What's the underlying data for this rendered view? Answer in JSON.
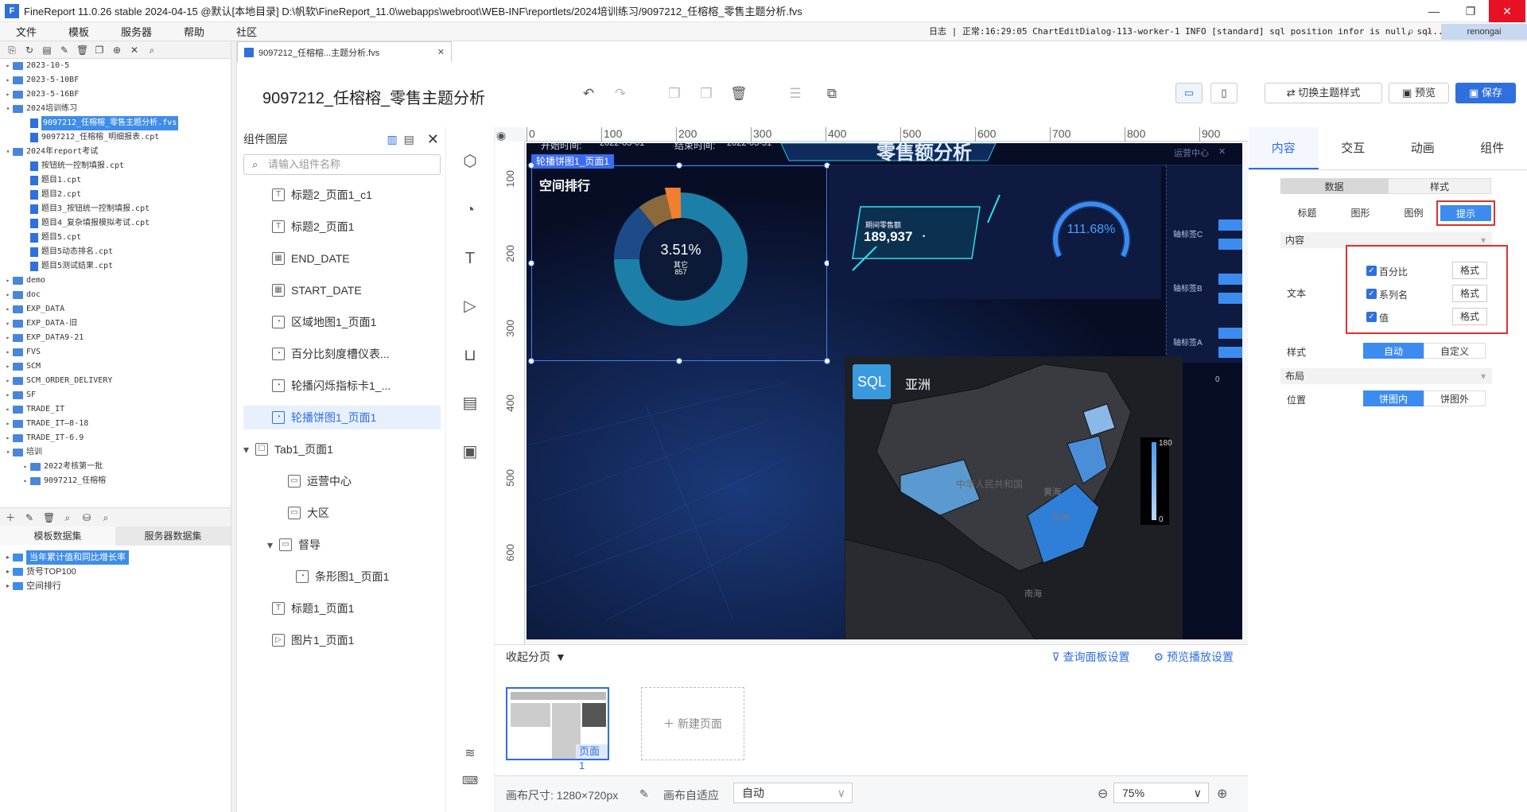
{
  "window": {
    "title": "FineReport 11.0.26 stable 2024-04-15 @默认[本地目录]    D:\\帆软\\FineReport_11.0\\webapps\\webroot\\WEB-INF\\reportlets/2024培训练习/9097212_任榕榕_零售主题分析.fvs",
    "logo_text": "F"
  },
  "menu": [
    "文件",
    "模板",
    "服务器",
    "帮助",
    "社区"
  ],
  "log": {
    "label": "日志",
    "line": "| 正常:16:29:05 ChartEditDialog-113-worker-1 INFO [standard] sql position infor is null, sql...",
    "user": "renongai"
  },
  "tree": [
    {
      "label": "2023-10-5",
      "type": "folder",
      "level": 0
    },
    {
      "label": "2023-5-10BF",
      "type": "folder",
      "level": 0
    },
    {
      "label": "2023-5-16BF",
      "type": "folder",
      "level": 0
    },
    {
      "label": "2024培训练习",
      "type": "folder",
      "level": 0,
      "open": true
    },
    {
      "label": "9097212_任榕榕_零售主题分析.fvs",
      "type": "file",
      "level": 1,
      "selected": true
    },
    {
      "label": "9097212_任榕榕_明细报表.cpt",
      "type": "file",
      "level": 1
    },
    {
      "label": "2024年report考试",
      "type": "folder",
      "level": 0,
      "open": true
    },
    {
      "label": "按钮统一控制填报.cpt",
      "type": "file",
      "level": 1
    },
    {
      "label": "题目1.cpt",
      "type": "file",
      "level": 1
    },
    {
      "label": "题目2.cpt",
      "type": "file",
      "level": 1
    },
    {
      "label": "题目3_按钮统一控制填报.cpt",
      "type": "file",
      "level": 1
    },
    {
      "label": "题目4_复杂填报模拟考试.cpt",
      "type": "file",
      "level": 1
    },
    {
      "label": "题目5.cpt",
      "type": "file",
      "level": 1
    },
    {
      "label": "题目5动态排名.cpt",
      "type": "file",
      "level": 1
    },
    {
      "label": "题目5测试结果.cpt",
      "type": "file",
      "level": 1
    },
    {
      "label": "demo",
      "type": "folder",
      "level": 0
    },
    {
      "label": "doc",
      "type": "folder",
      "level": 0
    },
    {
      "label": "EXP_DATA",
      "type": "folder",
      "level": 0
    },
    {
      "label": "EXP_DATA-旧",
      "type": "folder",
      "level": 0
    },
    {
      "label": "EXP_DATA9-21",
      "type": "folder",
      "level": 0
    },
    {
      "label": "FVS",
      "type": "folder",
      "level": 0
    },
    {
      "label": "SCM",
      "type": "folder",
      "level": 0
    },
    {
      "label": "SCM_ORDER_DELIVERY",
      "type": "folder",
      "level": 0
    },
    {
      "label": "SF",
      "type": "folder",
      "level": 0
    },
    {
      "label": "TRADE_IT",
      "type": "folder",
      "level": 0
    },
    {
      "label": "TRADE_IT—8-18",
      "type": "folder",
      "level": 0
    },
    {
      "label": "TRADE_IT-6.9",
      "type": "folder",
      "level": 0
    },
    {
      "label": "培训",
      "type": "folder",
      "level": 0,
      "open": true
    },
    {
      "label": "2022考核第一批",
      "type": "folder",
      "level": 1
    },
    {
      "label": "9097212_任榕榕",
      "type": "folder",
      "level": 1
    }
  ],
  "datasets": {
    "tabs": [
      "模板数据集",
      "服务器数据集"
    ],
    "items": [
      "当年累计值和同比增长率",
      "货号TOP100",
      "空间排行"
    ]
  },
  "doc_tab": "9097212_任榕榕...主题分析.fvs",
  "page_title": "9097212_任榕榕_零售主题分析",
  "toolbar": {
    "switch_theme": "切换主题样式",
    "preview": "预览",
    "save": "保存"
  },
  "layers": {
    "title": "组件图层",
    "search_placeholder": "请输入组件名称",
    "items": [
      {
        "label": "标题2_页面1_c1",
        "icon": "T",
        "indent": 0
      },
      {
        "label": "标题2_页面1",
        "icon": "T",
        "indent": 0
      },
      {
        "label": "END_DATE",
        "icon": "▦",
        "indent": 0
      },
      {
        "label": "START_DATE",
        "icon": "▦",
        "indent": 0
      },
      {
        "label": "区域地图1_页面1",
        "icon": "◔",
        "indent": 0
      },
      {
        "label": "百分比刻度槽仪表...",
        "icon": "◔",
        "indent": 0
      },
      {
        "label": "轮播闪烁指标卡1_...",
        "icon": "◔",
        "indent": 0
      },
      {
        "label": "轮播饼图1_页面1",
        "icon": "◔",
        "indent": 0,
        "selected": true
      },
      {
        "label": "Tab1_页面1",
        "icon": "☐",
        "indent": -1,
        "caret": true
      },
      {
        "label": "运营中心",
        "icon": "▭",
        "indent": 1
      },
      {
        "label": "大区",
        "icon": "▭",
        "indent": 1
      },
      {
        "label": "督导",
        "icon": "▭",
        "indent": 0.5,
        "caret": true
      },
      {
        "label": "条形图1_页面1",
        "icon": "◔",
        "indent": 1.5
      },
      {
        "label": "标题1_页面1",
        "icon": "T",
        "indent": 0
      },
      {
        "label": "图片1_页面1",
        "icon": "▷",
        "indent": 0
      }
    ]
  },
  "ruler": [
    "0",
    "100",
    "200",
    "300",
    "400",
    "500",
    "600",
    "700",
    "800",
    "900"
  ],
  "ruler_v": [
    "100",
    "200",
    "300",
    "400",
    "500",
    "600"
  ],
  "dashboard": {
    "heading": "零售额分析",
    "start_label": "开始时间:",
    "start_value": "2022-03-01",
    "end_label": "结束时间:",
    "end_value": "2022-03-31",
    "selected_component": "轮播饼图1_页面1",
    "pie_title": "空间排行",
    "pie_percent": "3.51%",
    "pie_label": "其它",
    "pie_value": "857",
    "kpi_label": "期间零售额",
    "kpi_value": "189,937",
    "kpi_suffix": "•",
    "gauge_value": "111.68%",
    "tab_label": "运营中心",
    "bar_labels": [
      "轴标签C",
      "轴标签B",
      "轴标签A"
    ],
    "bar_zero": "0",
    "map_logo": "SQL",
    "map_title": "亚洲",
    "map_labels": [
      "中华人民共和国",
      "黄海",
      "东海",
      "南海"
    ],
    "legend_max": "180",
    "legend_min": "0"
  },
  "pages": {
    "collapse": "收起分页",
    "query_settings": "查询面板设置",
    "play_settings": "预览播放设置",
    "page1": "页面1",
    "new_page": "新建页面"
  },
  "status": {
    "canvas_size": "画布尺寸: 1280×720px",
    "adapt_label": "画布自适应",
    "adapt_value": "自动",
    "zoom": "75%"
  },
  "right": {
    "tabs": [
      "内容",
      "交互",
      "动画",
      "组件"
    ],
    "subtabs": [
      "数据",
      "样式"
    ],
    "style_tabs": [
      "标题",
      "图形",
      "图例",
      "提示"
    ],
    "content_label": "内容",
    "text_label": "文本",
    "checks": [
      "百分比",
      "系列名",
      "值"
    ],
    "format": "格式",
    "style_label": "样式",
    "style_opts": [
      "自动",
      "自定义"
    ],
    "layout_label": "布局",
    "position_label": "位置",
    "position_opts": [
      "饼图内",
      "饼图外"
    ]
  }
}
